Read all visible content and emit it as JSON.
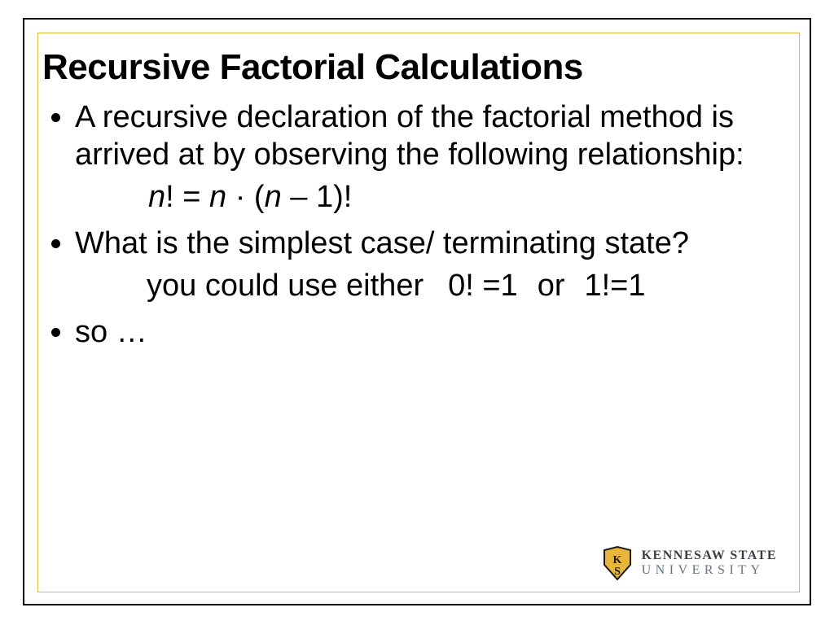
{
  "title": "Recursive Factorial Calculations",
  "bullets": {
    "b1": "A recursive declaration of the factorial method is arrived at by observing the following relationship:",
    "eq": {
      "n1": "n",
      "bang1": "! = ",
      "n2": "n",
      "dot": " · (",
      "n3": "n",
      "rest": " – 1)!"
    },
    "b2": "What is the simplest case/ terminating state?",
    "ans": {
      "lead": "you could use either",
      "opt1": "0! =1",
      "or": "or",
      "opt2": "1!=1"
    },
    "b3": "so …"
  },
  "logo": {
    "top": "KENNESAW STATE",
    "bot": "UNIVERSITY"
  }
}
